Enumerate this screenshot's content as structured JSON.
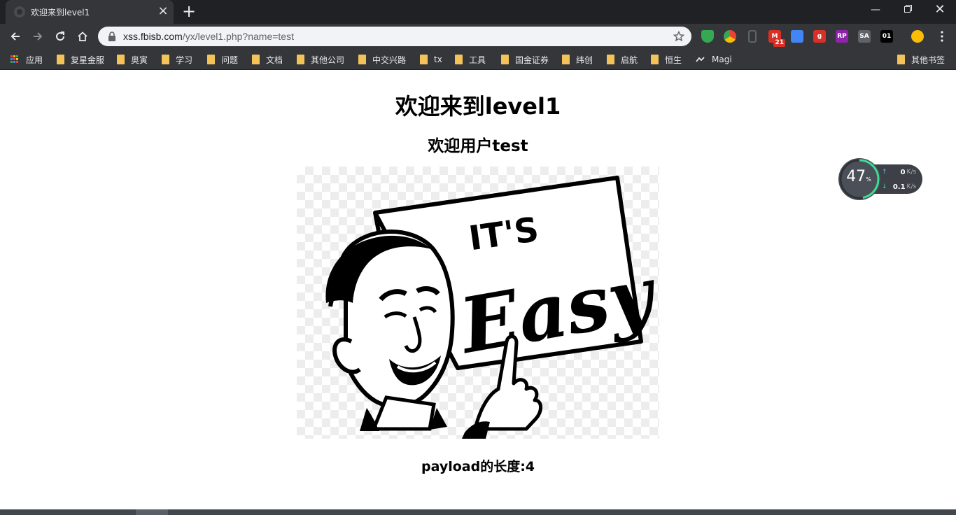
{
  "tab": {
    "title": "欢迎来到level1"
  },
  "toolbar": {
    "url_host": "xss.fbisb.com",
    "url_path": "/yx/level1.php?name=test"
  },
  "extensions": [
    {
      "name": "shield-extension-icon",
      "color": "#34a853",
      "label": ""
    },
    {
      "name": "chrome-extension-icon",
      "color": "#ea4335",
      "label": ""
    },
    {
      "name": "bookmark-extension-icon",
      "color": "#5f6368",
      "label": ""
    },
    {
      "name": "gmail-extension-icon",
      "color": "#d93025",
      "label": "M",
      "badge": "21"
    },
    {
      "name": "cube-extension-icon",
      "color": "#4285f4",
      "label": ""
    },
    {
      "name": "red-extension-icon",
      "color": "#d93025",
      "label": "g"
    },
    {
      "name": "rp-extension-icon",
      "color": "#8e24aa",
      "label": "RP"
    },
    {
      "name": "sa-extension-icon",
      "color": "#5f6368",
      "label": "SA"
    },
    {
      "name": "zero-one-extension-icon",
      "color": "#000000",
      "label": "01"
    },
    {
      "name": "profile-avatar-icon",
      "color": "#fbbc05",
      "label": ""
    }
  ],
  "bookmarks": {
    "apps": "应用",
    "items": [
      "复星金服",
      "奥寅",
      "学习",
      "问题",
      "文档",
      "其他公司",
      "中交兴路",
      "tx",
      "工具",
      "国金证券",
      "纬创",
      "启航",
      "恒生"
    ],
    "magi": "Magi",
    "other": "其他书签"
  },
  "page": {
    "heading": "欢迎来到level1",
    "welcome": "欢迎用户test",
    "payload_length": "payload的长度:4"
  },
  "image_text": {
    "line1": "IT'S",
    "line2": "Easy"
  },
  "speed_widget": {
    "percent": "47",
    "percent_unit": "%",
    "up_value": "0",
    "down_value": "0.1",
    "unit": "K/s"
  }
}
